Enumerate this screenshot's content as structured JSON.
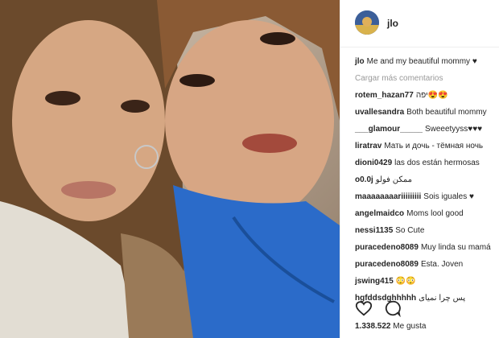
{
  "post": {
    "username": "jlo",
    "caption_user": "jlo",
    "caption_text": "Me and my beautiful mommy ♥",
    "load_more": "Cargar más comentarios",
    "comments": [
      {
        "user": "rotem_hazan77",
        "text": "יפה😍😍"
      },
      {
        "user": "uvallesandra",
        "text": "Both beautiful mommy"
      },
      {
        "user": "___glamour_____",
        "text": "Sweeetyyss♥♥♥"
      },
      {
        "user": "liratrav",
        "text": "Мать и дочь - тёмная ночь"
      },
      {
        "user": "dioni0429",
        "text": "las dos están hermosas"
      },
      {
        "user": "o0.0j",
        "text": "ممكن فولو"
      },
      {
        "user": "maaaaaaaariiiiiiiii",
        "text": "Sois iguales ♥"
      },
      {
        "user": "angelmaidco",
        "text": "Moms lool good"
      },
      {
        "user": "nessi1135",
        "text": "So Cute"
      },
      {
        "user": "puracedeno8089",
        "text": "Muy linda su mamá"
      },
      {
        "user": "puracedeno8089",
        "text": "Esta. Joven"
      },
      {
        "user": "jswing415",
        "text": "😳😳"
      },
      {
        "user": "hgfddsdghhhhh",
        "text": "پس چرا نمیای"
      }
    ],
    "likes_count": "1.338.522",
    "likes_label": "Me gusta"
  },
  "icons": [
    "heart-icon",
    "comment-icon"
  ],
  "colors": {
    "text": "#262626",
    "muted": "#999999",
    "border": "#efefef"
  }
}
